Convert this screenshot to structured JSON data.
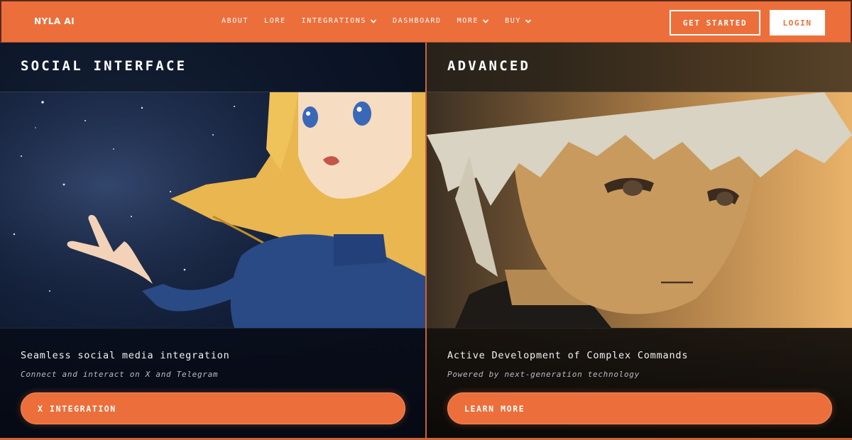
{
  "header": {
    "logo": "NYLA AI",
    "nav": [
      {
        "label": "ABOUT",
        "has_dropdown": false
      },
      {
        "label": "LORE",
        "has_dropdown": false
      },
      {
        "label": "INTEGRATIONS",
        "has_dropdown": true
      },
      {
        "label": "DASHBOARD",
        "has_dropdown": false
      },
      {
        "label": "MORE",
        "has_dropdown": true
      },
      {
        "label": "BUY",
        "has_dropdown": true
      }
    ],
    "get_started_label": "GET STARTED",
    "login_label": "LOGIN"
  },
  "panels": {
    "social": {
      "title": "SOCIAL INTERFACE",
      "headline": "Seamless social media integration",
      "subline": "Connect and interact on X and Telegram",
      "cta": "X INTEGRATION"
    },
    "advanced": {
      "title": "ADVANCED",
      "headline": "Active Development of Complex Commands",
      "subline": "Powered by next-generation technology",
      "cta": "LEARN MORE"
    }
  },
  "colors": {
    "brand_orange": "#ec6f3b",
    "night_blue": "#0f1a31",
    "sunset_gold": "#e3a55a"
  },
  "icons": [
    "chevron-down-icon"
  ]
}
